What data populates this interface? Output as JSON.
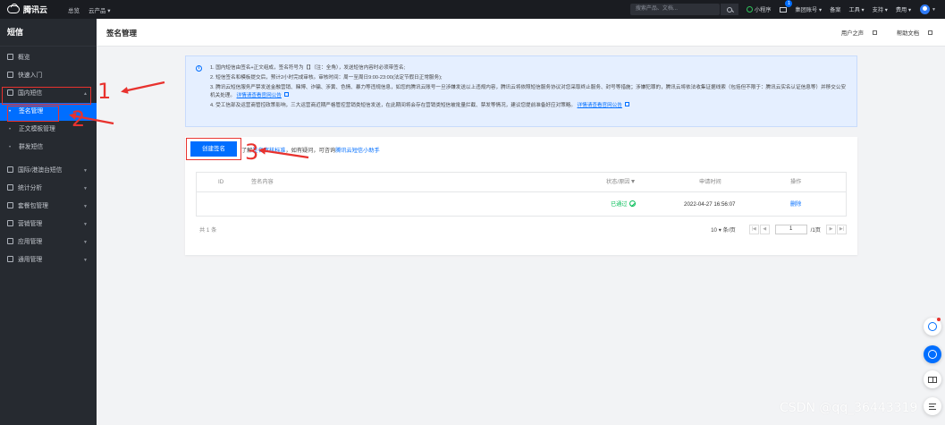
{
  "topbar": {
    "brand": "腾讯云",
    "nav": [
      "总览",
      "云产品 ▾"
    ],
    "search_placeholder": "搜索产品、文档...",
    "mini_program": "小程序",
    "message_badge": "1",
    "account": "集团账号 ▾",
    "items": [
      "备案",
      "工具 ▾",
      "支持 ▾",
      "费用 ▾"
    ]
  },
  "sidebar": {
    "title": "短信",
    "items": [
      {
        "label": "概览",
        "icon": "grid-icon"
      },
      {
        "label": "快速入门",
        "icon": "book-icon"
      },
      {
        "label": "国内短信",
        "icon": "message-icon"
      }
    ],
    "sub_items": [
      "签名管理",
      "正文模板管理",
      "群发短信"
    ],
    "more_items": [
      {
        "label": "国际/港澳台短信",
        "icon": "globe-icon"
      },
      {
        "label": "统计分析",
        "icon": "chart-icon"
      },
      {
        "label": "套餐包管理",
        "icon": "package-icon"
      },
      {
        "label": "营销管理",
        "icon": "users-icon"
      },
      {
        "label": "应用管理",
        "icon": "app-icon"
      },
      {
        "label": "通用管理",
        "icon": "list-icon"
      }
    ]
  },
  "header": {
    "title": "签名管理",
    "links": [
      "用户之声",
      "帮助文档"
    ]
  },
  "notice": {
    "lines": [
      {
        "text": "1. 国内短信由签名+正文组成，签名符号为【】（注：全角），发送短信内容时必须带签名;",
        "link": ""
      },
      {
        "text": "2. 短信签名和模板提交后，预计2小时完成审核。审核时间：周一至周日9:00-23:00(法定节假日正常服务);",
        "link": ""
      },
      {
        "text": "3. 腾讯云短信服务严禁发送金融营销、赌博、诈骗、涉黄、色情、暴力等违规信息，如您的腾讯云账号一旦涉嫌发送以上违规内容，腾讯云将依照短信服务协议对您采取终止服务、封号等措施；涉嫌犯罪的，腾讯云将依法收集证据线索（包括但不限于：腾讯云实名认证信息等）并移交公安机关处理。",
        "link": "详情请查看官网公告"
      },
      {
        "text": "4. 受工信部及运营商管控政策影响，三大运营商近期严格管控营销类短信发送，在此期间将会存在营销类短信被批量拦截、禁发等情况，建议您提前准备好应对策略。",
        "link": "详情请查看官网公告"
      }
    ]
  },
  "panel": {
    "create_button": "创建签名",
    "help_prefix": "了解",
    "help_link1": "签名审核标准",
    "help_middle": "，如有疑问，可咨询",
    "help_link2": "腾讯云短信小助手",
    "table": {
      "columns": [
        "ID",
        "签名内容",
        "状态/原因",
        "申请时间",
        "操作"
      ],
      "rows": [
        {
          "id": "",
          "content": "",
          "status": "已通过",
          "time": "2022-04-27 16:56:07",
          "action": "删除"
        }
      ]
    },
    "footer": {
      "total": "共 1 条",
      "page_size": "10 ▾ 条/页",
      "page": "1",
      "page_total": "/1页"
    }
  },
  "annotations": [
    "1",
    "2",
    "3"
  ],
  "watermark": "CSDN @qq_36443319",
  "colors": {
    "accent": "#006eff",
    "annotation": "#e8322e",
    "success": "#0abf5b"
  }
}
